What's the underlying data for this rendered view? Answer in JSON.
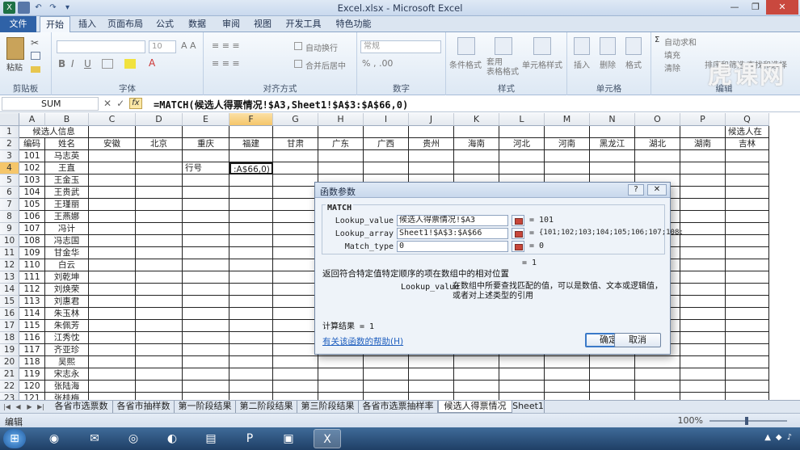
{
  "window": {
    "title": "Excel.xlsx - Microsoft Excel"
  },
  "tabs": [
    "文件",
    "开始",
    "插入",
    "页面布局",
    "公式",
    "数据",
    "审阅",
    "视图",
    "开发工具",
    "特色功能"
  ],
  "ribbon": {
    "groups": [
      "剪贴板",
      "字体",
      "对齐方式",
      "数字",
      "样式",
      "单元格",
      "编辑"
    ],
    "paste": "粘贴",
    "font_size": "10",
    "wrap": "自动换行",
    "merge": "合并后居中",
    "number_format": "常规",
    "cond_format": "条件格式",
    "table_format": "套用\n表格格式",
    "cell_style": "单元格样式",
    "insert": "插入",
    "delete": "删除",
    "format": "格式",
    "autosum": "自动求和",
    "fill": "填充",
    "clear": "清除",
    "sort": "排序和筛选",
    "find": "查找和选择",
    "watermark": "虎课网"
  },
  "formula_bar": {
    "name_box": "SUM",
    "fx": "fx",
    "formula": "=MATCH(候选人得票情况!$A3,Sheet1!$A$3:$A$66,0)"
  },
  "columns": [
    "A",
    "B",
    "C",
    "D",
    "E",
    "F",
    "G",
    "H",
    "I",
    "J",
    "K",
    "L",
    "M",
    "N",
    "O",
    "P",
    "Q"
  ],
  "row_numbers": [
    "1",
    "2",
    "3",
    "4",
    "5",
    "6",
    "7",
    "8",
    "9",
    "10",
    "11",
    "12",
    "13",
    "14",
    "15",
    "16",
    "17",
    "18",
    "19",
    "20",
    "21",
    "22",
    "23"
  ],
  "sheet": {
    "header_a1": "候选人信息",
    "header_q1": "候选人在",
    "row2": [
      "编码",
      "姓名",
      "安徽",
      "北京",
      "重庆",
      "福建",
      "甘肃",
      "广东",
      "广西",
      "贵州",
      "海南",
      "河北",
      "河南",
      "黑龙江",
      "湖北",
      "湖南",
      "吉林"
    ],
    "records": [
      [
        "101",
        "马志英"
      ],
      [
        "102",
        "王直"
      ],
      [
        "103",
        "王金玉"
      ],
      [
        "104",
        "王贵武"
      ],
      [
        "105",
        "王瑾丽"
      ],
      [
        "106",
        "王燕娜"
      ],
      [
        "107",
        "冯计"
      ],
      [
        "108",
        "冯志国"
      ],
      [
        "109",
        "甘金华"
      ],
      [
        "110",
        "白云"
      ],
      [
        "111",
        "刘乾坤"
      ],
      [
        "112",
        "刘焕荣"
      ],
      [
        "113",
        "刘惠君"
      ],
      [
        "114",
        "朱玉林"
      ],
      [
        "115",
        "朱佩芳"
      ],
      [
        "116",
        "江秀忱"
      ],
      [
        "117",
        "齐亚珍"
      ],
      [
        "118",
        "吴熙"
      ],
      [
        "119",
        "宋志永"
      ],
      [
        "120",
        "张陆海"
      ],
      [
        "121",
        "张桂梅"
      ]
    ],
    "e4": "行号",
    "f4": ":A$66,0)"
  },
  "sheet_tabs": [
    "各省市选票数",
    "各省市抽样数",
    "第一阶段结果",
    "第二阶段结果",
    "第三阶段结果",
    "各省市选票抽样率",
    "候选人得票情况",
    "Sheet1"
  ],
  "active_sheet": "候选人得票情况",
  "status": {
    "mode": "编辑",
    "zoom": "100%"
  },
  "dialog": {
    "title": "函数参数",
    "function_name": "MATCH",
    "args": [
      {
        "label": "Lookup_value",
        "input": "候选人得票情况!$A3",
        "result": "101"
      },
      {
        "label": "Lookup_array",
        "input": "Sheet1!$A$3:$A$66",
        "result": "{101;102;103;104;105;106;107;108;"
      },
      {
        "label": "Match_type",
        "input": "0",
        "result": "0"
      }
    ],
    "eq": "=",
    "total_result_line": "= 1",
    "description": "返回符合特定值特定顺序的项在数组中的相对位置",
    "arg_desc_name": "Lookup_value",
    "arg_desc_text": "在数组中所要查找匹配的值，可以是数值、文本或逻辑值，或者对上述类型的引用",
    "calc_result": "计算结果 = 1",
    "help_link": "有关该函数的帮助(H)",
    "ok": "确定",
    "cancel": "取消"
  },
  "colors": {
    "file_tab": "#2f62a7",
    "selected_header": "#f5c66a",
    "taskbar": "#1f3f66"
  }
}
